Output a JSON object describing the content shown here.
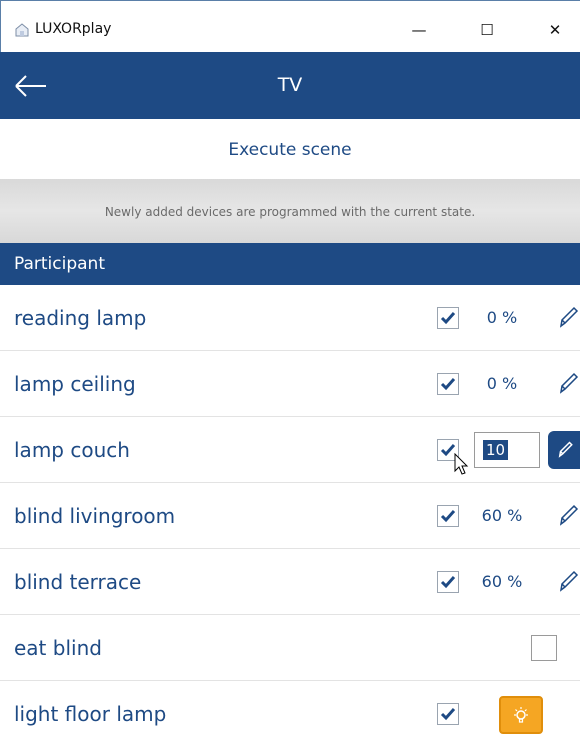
{
  "window": {
    "title": "LUXORplay",
    "controls": {
      "minimize": "—",
      "maximize": "☐",
      "close": "✕"
    }
  },
  "header": {
    "title": "TV"
  },
  "scene": {
    "execute_label": "Execute scene",
    "notice": "Newly added devices are programmed with the current state."
  },
  "section": {
    "title": "Participant"
  },
  "participants": [
    {
      "label": "reading lamp",
      "checked": true,
      "value": "0 %"
    },
    {
      "label": "lamp ceiling",
      "checked": true,
      "value": "0 %"
    },
    {
      "label": "lamp couch",
      "checked": true,
      "value": "10",
      "editing": true
    },
    {
      "label": "blind livingroom",
      "checked": true,
      "value": "60 %"
    },
    {
      "label": "blind terrace",
      "checked": true,
      "value": "60 %"
    },
    {
      "label": "eat blind",
      "checked": false
    },
    {
      "label": "light floor lamp",
      "checked": true,
      "control": "lightbulb-icon"
    }
  ],
  "colors": {
    "brand_blue": "#1e4a84",
    "bulb_orange": "#f5a623"
  }
}
